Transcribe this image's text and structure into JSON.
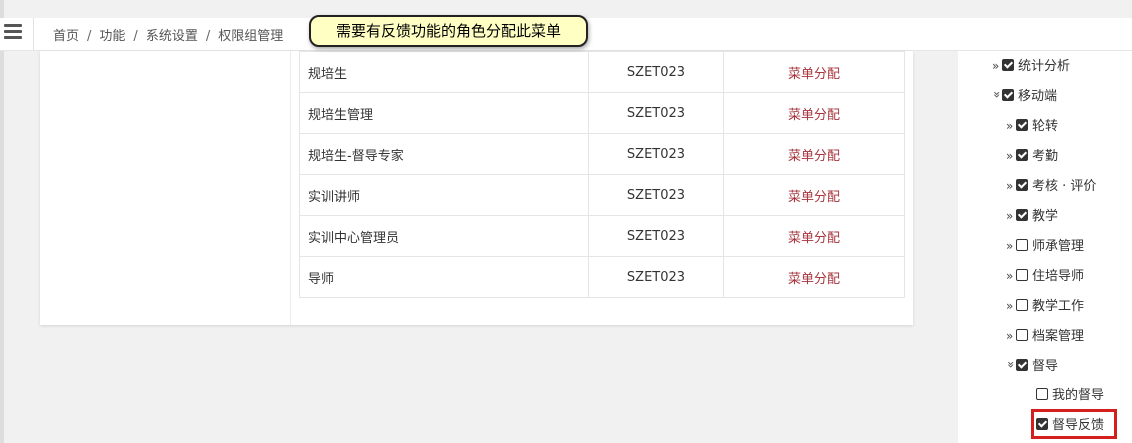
{
  "topbar": {
    "breadcrumb": [
      "首页",
      "功能",
      "系统设置",
      "权限组管理"
    ],
    "separator": "/"
  },
  "tooltip": {
    "text": "需要有反馈功能的角色分配此菜单"
  },
  "table": {
    "rows": [
      {
        "name": "规培生",
        "code": "SZET023",
        "action": "菜单分配"
      },
      {
        "name": "规培生管理",
        "code": "SZET023",
        "action": "菜单分配"
      },
      {
        "name": "规培生-督导专家",
        "code": "SZET023",
        "action": "菜单分配"
      },
      {
        "name": "实训讲师",
        "code": "SZET023",
        "action": "菜单分配"
      },
      {
        "name": "实训中心管理员",
        "code": "SZET023",
        "action": "菜单分配"
      },
      {
        "name": "导师",
        "code": "SZET023",
        "action": "菜单分配"
      }
    ]
  },
  "tree": {
    "items": [
      {
        "label": "统计分析",
        "toggle": "»",
        "checked": true
      },
      {
        "label": "移动端",
        "toggle": "»",
        "checked": true,
        "expanded": true
      },
      {
        "label": "轮转",
        "toggle": "»",
        "checked": true
      },
      {
        "label": "考勤",
        "toggle": "»",
        "checked": true
      },
      {
        "label": "考核 · 评价",
        "toggle": "»",
        "checked": true
      },
      {
        "label": "教学",
        "toggle": "»",
        "checked": true
      },
      {
        "label": "师承管理",
        "toggle": "»",
        "checked": false
      },
      {
        "label": "住培导师",
        "toggle": "»",
        "checked": false
      },
      {
        "label": "教学工作",
        "toggle": "»",
        "checked": false
      },
      {
        "label": "档案管理",
        "toggle": "»",
        "checked": false
      },
      {
        "label": "督导",
        "toggle": "»",
        "checked": true,
        "expanded": true
      },
      {
        "label": "我的督导",
        "toggle": "",
        "checked": false
      },
      {
        "label": "督导反馈",
        "toggle": "",
        "checked": true
      }
    ]
  },
  "colors": {
    "action": "#a6353d",
    "highlight": "#d51f1f",
    "tooltip_bg": "#ffffc4"
  }
}
